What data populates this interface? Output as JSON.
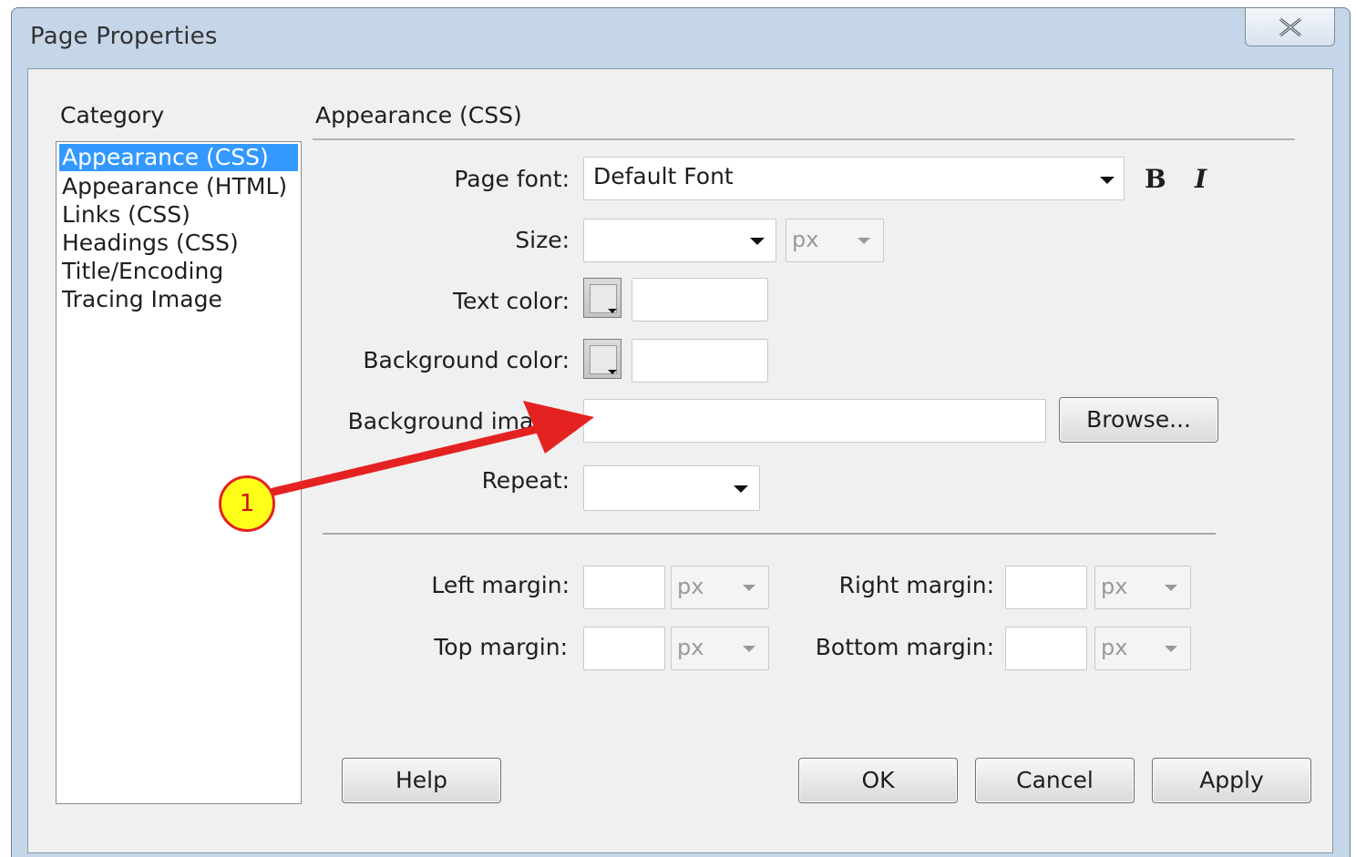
{
  "window": {
    "title": "Page Properties"
  },
  "category": {
    "heading": "Category",
    "items": [
      {
        "label": "Appearance (CSS)",
        "selected": true
      },
      {
        "label": "Appearance (HTML)",
        "selected": false
      },
      {
        "label": "Links (CSS)",
        "selected": false
      },
      {
        "label": "Headings (CSS)",
        "selected": false
      },
      {
        "label": "Title/Encoding",
        "selected": false
      },
      {
        "label": "Tracing Image",
        "selected": false
      }
    ]
  },
  "section": {
    "heading": "Appearance (CSS)"
  },
  "form": {
    "page_font": {
      "label": "Page font:",
      "value": "Default Font"
    },
    "bold_label": "B",
    "italic_label": "I",
    "size": {
      "label": "Size:",
      "value": "",
      "unit": "px"
    },
    "text_color": {
      "label": "Text color:",
      "value": ""
    },
    "background_color": {
      "label": "Background color:",
      "value": ""
    },
    "background_image": {
      "label": "Background image:",
      "value": "",
      "browse_label": "Browse..."
    },
    "repeat": {
      "label": "Repeat:",
      "value": ""
    },
    "left_margin": {
      "label": "Left margin:",
      "value": "",
      "unit": "px"
    },
    "right_margin": {
      "label": "Right margin:",
      "value": "",
      "unit": "px"
    },
    "top_margin": {
      "label": "Top margin:",
      "value": "",
      "unit": "px"
    },
    "bottom_margin": {
      "label": "Bottom margin:",
      "value": "",
      "unit": "px"
    }
  },
  "buttons": {
    "help": "Help",
    "ok": "OK",
    "cancel": "Cancel",
    "apply": "Apply"
  },
  "annotation": {
    "marker_label": "1",
    "color": "#e52222",
    "marker_fill": "#ffff1a"
  },
  "icons": {
    "close": "close-icon",
    "dropdown": "chevron-down-icon",
    "color_picker": "color-swatch-icon"
  }
}
